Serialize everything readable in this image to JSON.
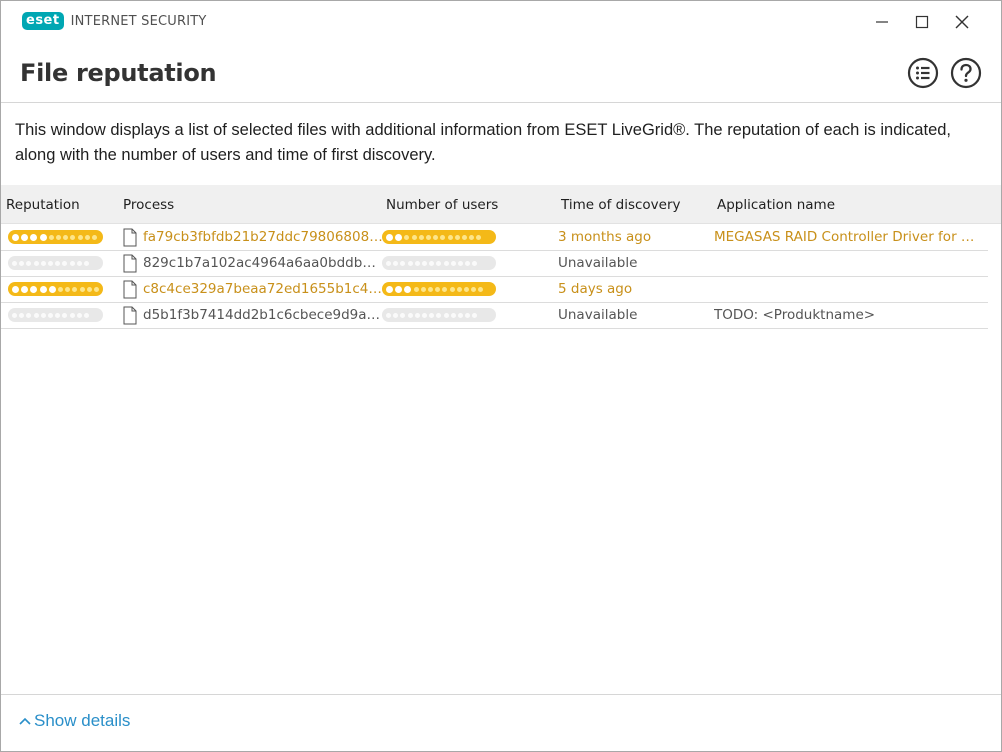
{
  "app": {
    "logo_text": "eset",
    "product_name": "INTERNET SECURITY"
  },
  "window_controls": [
    "minimize-icon",
    "maximize-icon",
    "close-icon"
  ],
  "header": {
    "title": "File reputation",
    "icons": [
      "list-icon",
      "help-icon"
    ]
  },
  "description": "This window displays a list of selected files with additional information from ESET LiveGrid®. The reputation of each is indicated, along with the number of users and time of first discovery.",
  "table": {
    "columns": [
      "Reputation",
      "Process",
      "Number of users",
      "Time of discovery",
      "Application name"
    ],
    "rows": [
      {
        "reputation_level": 4,
        "users_level": 2,
        "process": "fa79cb3fbfdb21b27ddc798068081ce...",
        "time": "3 months ago",
        "application": "MEGASAS RAID Controller Driver for Wind...",
        "highlight": true
      },
      {
        "reputation_level": 0,
        "users_level": 0,
        "process": "829c1b7a102ac4964a6aa0bddbde8...",
        "time": "Unavailable",
        "application": "",
        "highlight": false
      },
      {
        "reputation_level": 5,
        "users_level": 3,
        "process": "c8c4ce329a7beaa72ed1655b1c4ab6...",
        "time": "5 days ago",
        "application": "",
        "highlight": true
      },
      {
        "reputation_level": 0,
        "users_level": 0,
        "process": "d5b1f3b7414dd2b1c6cbece9d9a1b7...",
        "time": "Unavailable",
        "application": "TODO: <Produktname>",
        "highlight": false
      }
    ]
  },
  "footer": {
    "show_details_label": "Show details"
  },
  "colors": {
    "brand": "#00a7b3",
    "warning": "#c8901a",
    "meter": "#f4b918",
    "link": "#2a8fc9"
  }
}
